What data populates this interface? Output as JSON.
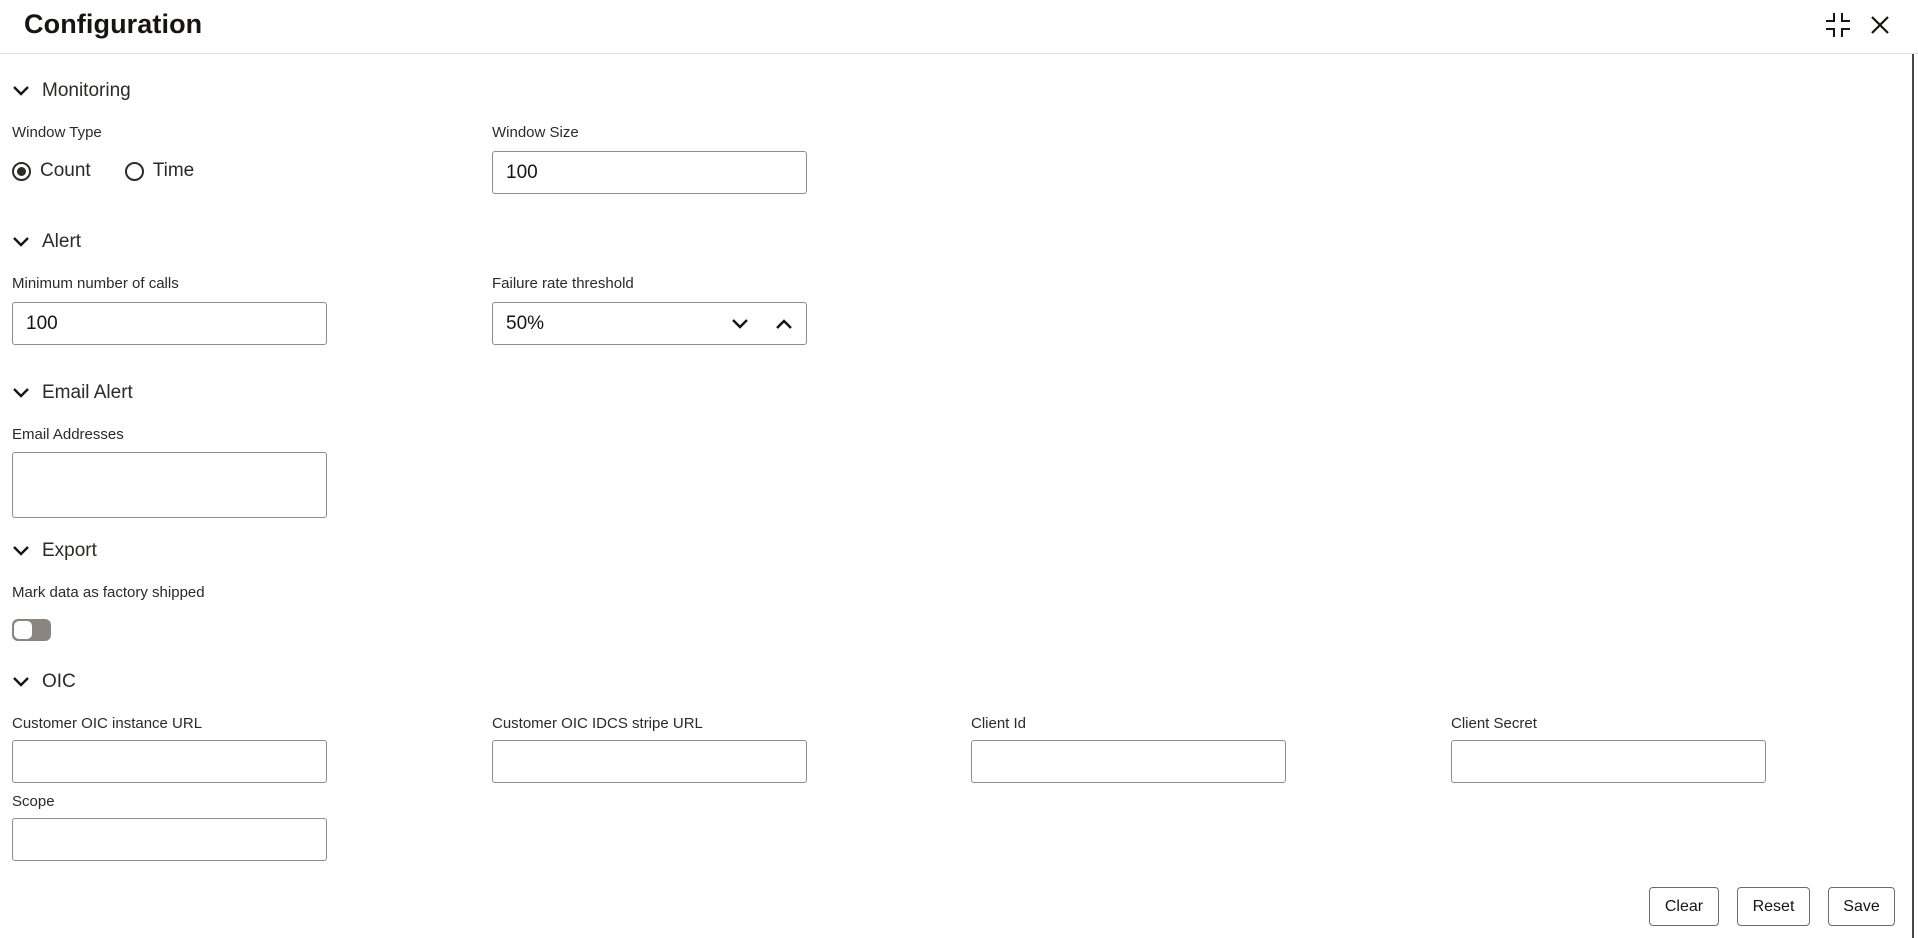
{
  "dialog": {
    "title": "Configuration"
  },
  "monitoring": {
    "section_title": "Monitoring",
    "window_type": {
      "label": "Window Type",
      "options": [
        "Count",
        "Time"
      ],
      "selected": "Count"
    },
    "window_size": {
      "label": "Window Size",
      "value": "100"
    }
  },
  "alert": {
    "section_title": "Alert",
    "min_calls": {
      "label": "Minimum number of calls",
      "value": "100"
    },
    "failure_rate": {
      "label": "Failure rate threshold",
      "value": "50%"
    }
  },
  "email_alert": {
    "section_title": "Email Alert",
    "email_addresses": {
      "label": "Email Addresses",
      "value": ""
    }
  },
  "export": {
    "section_title": "Export",
    "factory_shipped": {
      "label": "Mark data as factory shipped",
      "on": false
    }
  },
  "oic": {
    "section_title": "OIC",
    "instance_url": {
      "label": "Customer OIC instance URL",
      "value": ""
    },
    "idcs_url": {
      "label": "Customer OIC IDCS stripe URL",
      "value": ""
    },
    "client_id": {
      "label": "Client Id",
      "value": ""
    },
    "client_secret": {
      "label": "Client Secret",
      "value": ""
    },
    "scope": {
      "label": "Scope",
      "value": ""
    }
  },
  "footer": {
    "clear_label": "Clear",
    "reset_label": "Reset",
    "save_label": "Save"
  },
  "icons": {
    "collapse": "collapse-icon",
    "close": "close-icon",
    "chevron": "chevron-down-icon"
  }
}
